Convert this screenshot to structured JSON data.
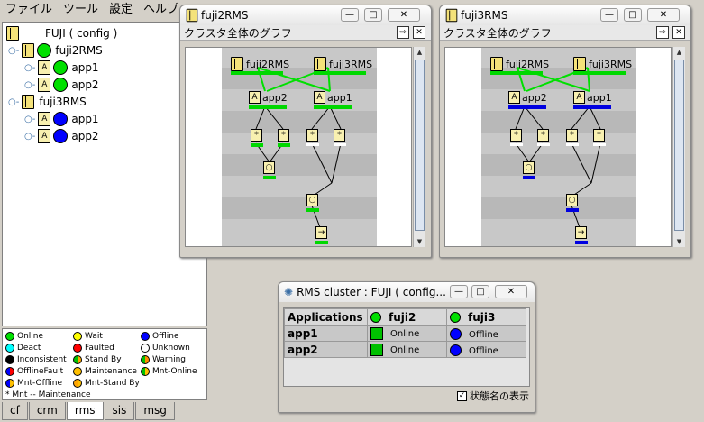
{
  "menu": [
    "ファイル",
    "ツール",
    "設定",
    "ヘルプ"
  ],
  "tree": {
    "root": "FUJI ( config )",
    "nodes": [
      {
        "label": "fuji2RMS",
        "apps": [
          "app1",
          "app2"
        ],
        "app_states": [
          "online",
          "online"
        ]
      },
      {
        "label": "fuji3RMS",
        "apps": [
          "app1",
          "app2"
        ],
        "app_states": [
          "offline",
          "offline"
        ]
      }
    ]
  },
  "legend": [
    {
      "label": "Online",
      "color": "#00e000"
    },
    {
      "label": "Wait",
      "color": "#ffff00"
    },
    {
      "label": "Offline",
      "color": "#0000ff"
    },
    {
      "label": "Deact",
      "color": "#00ffff"
    },
    {
      "label": "Faulted",
      "color": "#ff0000"
    },
    {
      "label": "Unknown",
      "color": "#ffffff"
    },
    {
      "label": "Inconsistent",
      "color": "#000000"
    },
    {
      "label": "Stand By",
      "color": "#ffa500"
    },
    {
      "label": "Warning",
      "color": "#ff8c00"
    },
    {
      "label": "OfflineFault",
      "color": "#cc00cc"
    },
    {
      "label": "Maintenance",
      "color": "#ffc000"
    },
    {
      "label": "Mnt-Online",
      "color": "#88cc00"
    },
    {
      "label": "Mnt-Offline",
      "color": "#4466ff"
    },
    {
      "label": "Mnt-Stand By",
      "color": "#ffcc33"
    }
  ],
  "legend_note": "* Mnt -- Maintenance",
  "tabs": [
    "cf",
    "crm",
    "rms",
    "sis",
    "msg"
  ],
  "selected_tab": "rms",
  "win1": {
    "title": "fuji2RMS",
    "subtitle": "クラスタ全体のグラフ",
    "host1": "fuji2RMS",
    "host2": "fuji3RMS",
    "app2": "app2",
    "app1": "app1"
  },
  "win2": {
    "title": "fuji3RMS",
    "subtitle": "クラスタ全体のグラフ",
    "host1": "fuji2RMS",
    "host2": "fuji3RMS",
    "app2": "app2",
    "app1": "app1"
  },
  "win3": {
    "title": "RMS cluster : FUJI ( config...",
    "col_apps": "Applications",
    "col_n1": "fuji2",
    "col_n2": "fuji3",
    "rows": [
      {
        "app": "app1",
        "s1": "Online",
        "s2": "Offline"
      },
      {
        "app": "app2",
        "s1": "Online",
        "s2": "Offline"
      }
    ],
    "checkbox_label": "状態名の表示",
    "checkbox_checked": true
  },
  "icons": {
    "minimize": "minimize-icon",
    "maximize": "maximize-icon",
    "close": "close-icon"
  }
}
